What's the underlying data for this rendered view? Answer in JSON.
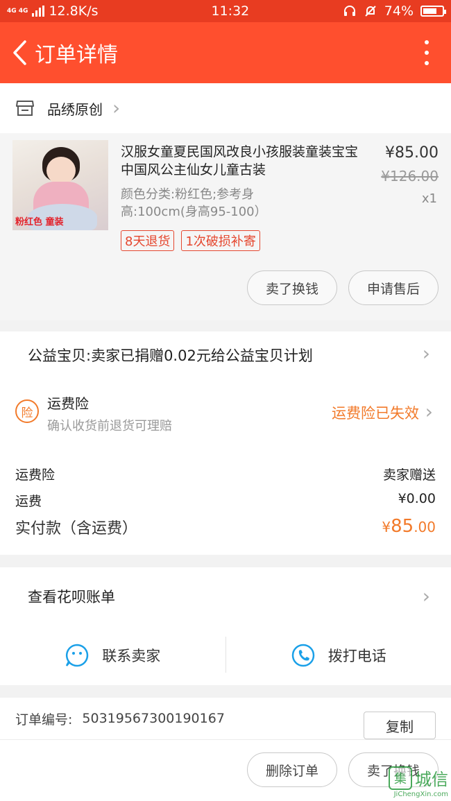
{
  "statusbar": {
    "network": "4G 4G",
    "speed": "12.8K/s",
    "time": "11:32",
    "battery": "74%",
    "battery_level": 0.74
  },
  "header": {
    "title": "订单详情"
  },
  "shop": {
    "name": "品绣原创"
  },
  "item": {
    "title": "汉服女童夏民国风改良小孩服装童装宝宝中国风公主仙女儿童古装",
    "sku": "颜色分类:粉红色;参考身高:100cm(身高95-100）",
    "price": "¥85.00",
    "original_price": "¥126.00",
    "quantity": "x1",
    "image_watermark": "粉红色 童装",
    "tags": [
      "8天退货",
      "1次破损补寄"
    ],
    "actions": {
      "sell": "卖了换钱",
      "after_sale": "申请售后"
    }
  },
  "charity": {
    "text": "公益宝贝:卖家已捐赠0.02元给公益宝贝计划"
  },
  "insurance": {
    "icon_char": "险",
    "title": "运费险",
    "subtitle": "确认收货前退货可理赔",
    "status": "运费险已失效"
  },
  "fees": {
    "insurance_label": "运费险",
    "insurance_value": "卖家赠送",
    "shipping_label": "运费",
    "shipping_value": "¥0.00",
    "total_label": "实付款（含运费）",
    "total_currency": "¥",
    "total_int": "85",
    "total_dec": ".00"
  },
  "huabei": {
    "text": "查看花呗账单"
  },
  "contact": {
    "seller": "联系卖家",
    "phone": "拨打电话"
  },
  "order": {
    "label": "订单编号:",
    "number": "50319567300190167",
    "copy": "复制"
  },
  "bottom": {
    "delete": "删除订单",
    "sell": "卖了换钱"
  },
  "watermark": {
    "site": "城信",
    "url": "JiChengXin.com"
  },
  "colors": {
    "header": "#ff4f2e",
    "accent": "#f27a2a",
    "tag": "#e5472f"
  }
}
